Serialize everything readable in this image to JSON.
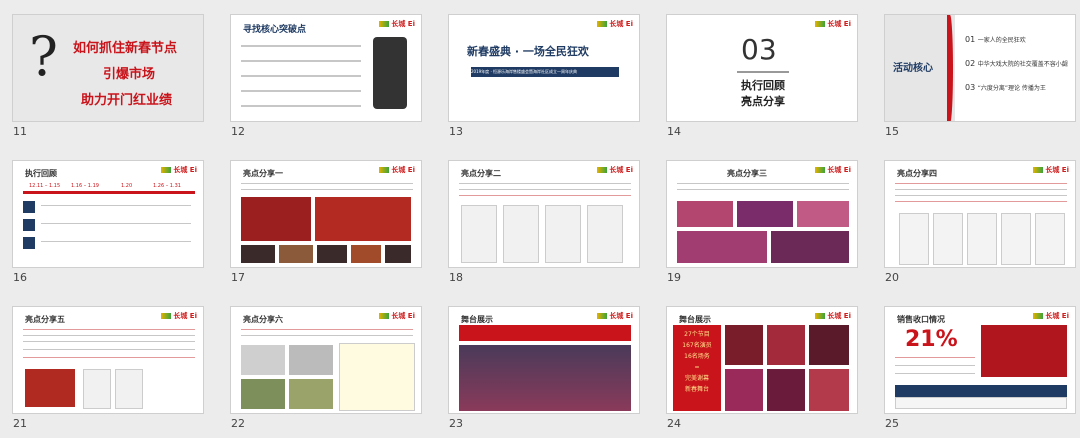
{
  "slides": [
    {
      "num": "11",
      "lines": [
        "如何抓住新春节点",
        "引爆市场",
        "助力开门红业绩"
      ],
      "mark": "?"
    },
    {
      "num": "12",
      "title": "寻找核心突破点",
      "logo": "长城 Ei"
    },
    {
      "num": "13",
      "title": "新春盛典 · 一场全民狂欢",
      "subtitle": "2019年度 · 恒源乐海岸售楼盛会暨海岸社区成立一周年庆典",
      "logo": "长城 Ei"
    },
    {
      "num": "14",
      "big": "03",
      "sub1": "执行回顾",
      "sub2": "亮点分享",
      "logo": "长城 Ei"
    },
    {
      "num": "15",
      "title": "活动核心",
      "items": [
        {
          "n": "01",
          "t": "一家人的全民狂欢"
        },
        {
          "n": "02",
          "t": "中华大戏大院的社交覆盖不容小觑"
        },
        {
          "n": "03",
          "t": "“六度分离”理论 传播为王"
        }
      ]
    },
    {
      "num": "16",
      "title": "执行回顾",
      "dates": [
        "12.11 – 1.15",
        "1.16 – 1.19",
        "1.20",
        "1.26 – 1.31"
      ],
      "logo": "长城 Ei"
    },
    {
      "num": "17",
      "title": "亮点分享一",
      "logo": "长城 Ei"
    },
    {
      "num": "18",
      "title": "亮点分享二",
      "logo": "长城 Ei"
    },
    {
      "num": "19",
      "title": "亮点分享三",
      "logo": "长城 Ei"
    },
    {
      "num": "20",
      "title": "亮点分享四",
      "logo": "长城 Ei"
    },
    {
      "num": "21",
      "title": "亮点分享五",
      "logo": "长城 Ei"
    },
    {
      "num": "22",
      "title": "亮点分享六",
      "logo": "长城 Ei"
    },
    {
      "num": "23",
      "title": "舞台展示",
      "logo": "长城 Ei"
    },
    {
      "num": "24",
      "title": "舞台展示",
      "stats": [
        "27个节目",
        "167名演员",
        "16名场务",
        "=",
        "完美谢幕",
        "新春舞台"
      ],
      "logo": "长城 Ei"
    },
    {
      "num": "25",
      "title": "销售收口情况",
      "big": "21%",
      "logo": "长城 Ei"
    }
  ]
}
